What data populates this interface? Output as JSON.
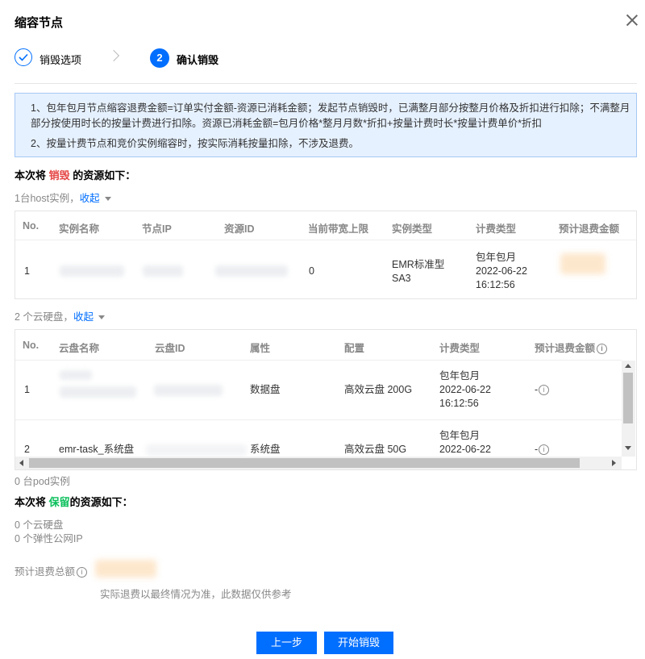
{
  "dialog": {
    "title": "缩容节点",
    "close_icon": "close-icon"
  },
  "steps": [
    {
      "label": "销毁选项",
      "state": "done"
    },
    {
      "number": "2",
      "label": "确认销毁",
      "state": "active"
    }
  ],
  "notice": {
    "line1": "1、包年包月节点缩容退费金额=订单实付金额-资源已消耗金额；发起节点销毁时，已满整月部分按整月价格及折扣进行扣除；不满整月",
    "line2": "部分按使用时长的按量计费进行扣除。资源已消耗金额=包月价格*整月月数*折扣+按量计费时长*按量计费单价*折扣",
    "line3": "2、按量计费节点和竞价实例缩容时，按实际消耗按量扣除，不涉及退费。"
  },
  "destroy_section": {
    "prefix": "本次将",
    "keyword": "销毁",
    "suffix": "的资源如下："
  },
  "host_group": {
    "count_text": "1台host实例，",
    "toggle": "收起"
  },
  "host_table": {
    "headers": [
      "No.",
      "实例名称",
      "节点IP",
      "资源ID",
      "当前带宽上限",
      "实例类型",
      "计费类型",
      "预计退费金额"
    ],
    "rows": [
      {
        "no": "1",
        "bandwidth": "0",
        "type_line1": "EMR标准型",
        "type_line2": "SA3",
        "billing_line1": "包年包月",
        "billing_line2": "2022-06-22",
        "billing_line3": "16:12:56"
      }
    ]
  },
  "disk_group": {
    "count_text": "2 个云硬盘，",
    "toggle": "收起"
  },
  "disk_table": {
    "headers": [
      "No.",
      "云盘名称",
      "云盘ID",
      "属性",
      "配置",
      "计费类型",
      "预计退费金额"
    ],
    "rows": [
      {
        "no": "1",
        "name": "",
        "attr": "数据盘",
        "config": "高效云盘 200G",
        "billing_line1": "包年包月",
        "billing_line2": "2022-06-22",
        "billing_line3": "16:12:56",
        "refund": "-"
      },
      {
        "no": "2",
        "name": "emr-task_系统盘",
        "attr": "系统盘",
        "config": "高效云盘 50G",
        "billing_line1": "包年包月",
        "billing_line2": "2022-06-22",
        "refund": "-"
      }
    ]
  },
  "pod_text": "0 台pod实例",
  "keep_section": {
    "prefix": "本次将",
    "keyword": "保留",
    "suffix": "的资源如下："
  },
  "keep_items": [
    "0 个云硬盘",
    "0 个弹性公网IP"
  ],
  "refund_total": {
    "label": "预计退费总额",
    "note": "实际退费以最终情况为准，此数据仅供参考"
  },
  "buttons": {
    "prev": "上一步",
    "start": "开始销毁"
  },
  "colors": {
    "primary": "#006eff",
    "danger": "#e54545",
    "success": "#0abf5b",
    "notice_bg": "#e6f1ff"
  }
}
